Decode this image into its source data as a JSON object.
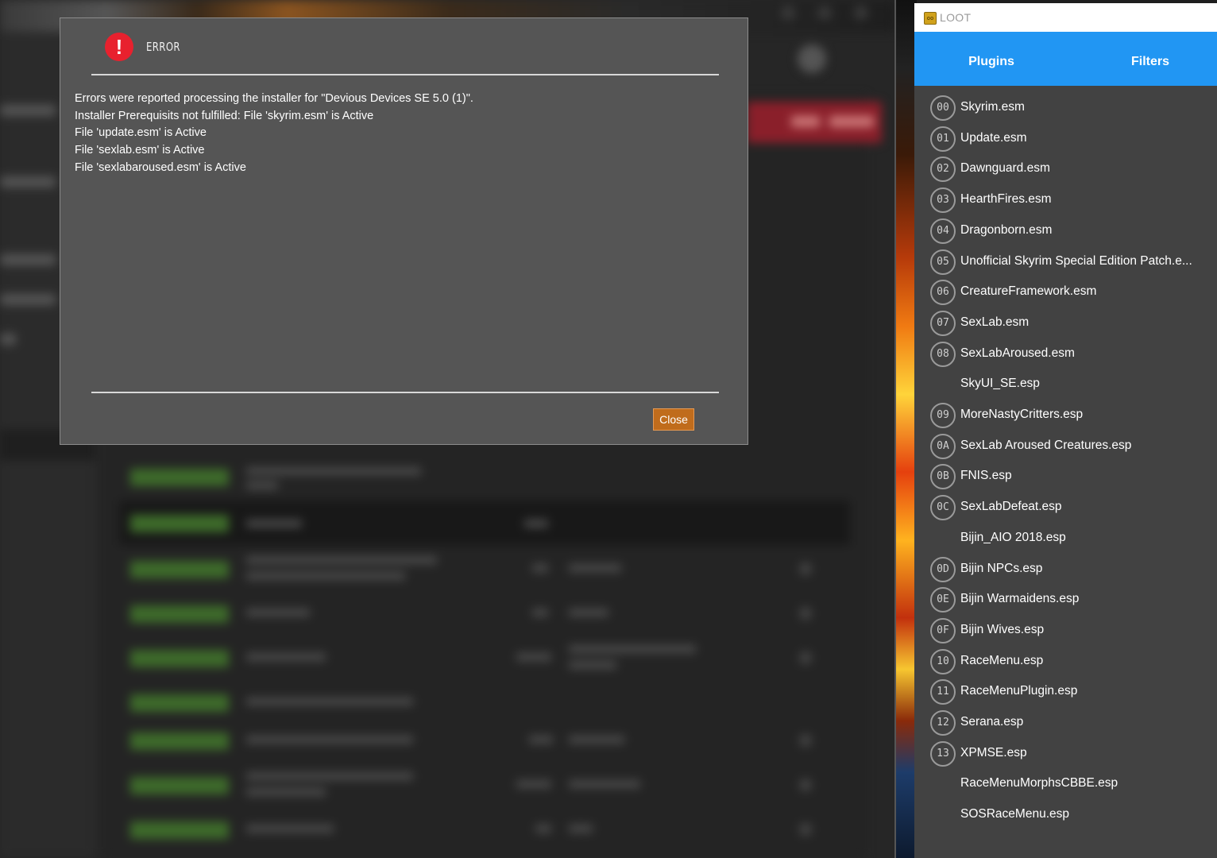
{
  "error_dialog": {
    "title": "ERROR",
    "messages": [
      "Errors were reported processing the installer for \"Devious Devices SE 5.0 (1)\".",
      "Installer Prerequisits not fulfilled: File 'skyrim.esm' is Active",
      "File 'update.esm' is Active",
      "File 'sexlab.esm' is Active",
      "File 'sexlabaroused.esm' is Active"
    ],
    "close_label": "Close",
    "colors": {
      "dialog_bg": "#555555",
      "error_icon": "#e8212e",
      "close_button": "#c06c1c"
    }
  },
  "loot": {
    "window_title": "LOOT",
    "tabs": {
      "plugins": "Plugins",
      "filters": "Filters"
    },
    "accent_color": "#2196f3",
    "plugins": [
      {
        "index": "00",
        "name": "Skyrim.esm"
      },
      {
        "index": "01",
        "name": "Update.esm"
      },
      {
        "index": "02",
        "name": "Dawnguard.esm"
      },
      {
        "index": "03",
        "name": "HearthFires.esm"
      },
      {
        "index": "04",
        "name": "Dragonborn.esm"
      },
      {
        "index": "05",
        "name": "Unofficial Skyrim Special Edition Patch.e..."
      },
      {
        "index": "06",
        "name": "CreatureFramework.esm"
      },
      {
        "index": "07",
        "name": "SexLab.esm"
      },
      {
        "index": "08",
        "name": "SexLabAroused.esm"
      },
      {
        "index": "",
        "name": "SkyUI_SE.esp"
      },
      {
        "index": "09",
        "name": "MoreNastyCritters.esp"
      },
      {
        "index": "0A",
        "name": "SexLab Aroused Creatures.esp"
      },
      {
        "index": "0B",
        "name": "FNIS.esp"
      },
      {
        "index": "0C",
        "name": "SexLabDefeat.esp"
      },
      {
        "index": "",
        "name": "Bijin_AIO 2018.esp"
      },
      {
        "index": "0D",
        "name": "Bijin NPCs.esp"
      },
      {
        "index": "0E",
        "name": "Bijin Warmaidens.esp"
      },
      {
        "index": "0F",
        "name": "Bijin Wives.esp"
      },
      {
        "index": "10",
        "name": "RaceMenu.esp"
      },
      {
        "index": "11",
        "name": "RaceMenuPlugin.esp"
      },
      {
        "index": "12",
        "name": "Serana.esp"
      },
      {
        "index": "13",
        "name": "XPMSE.esp"
      },
      {
        "index": "",
        "name": "RaceMenuMorphsCBBE.esp"
      },
      {
        "index": "",
        "name": "SOSRaceMenu.esp"
      }
    ]
  }
}
